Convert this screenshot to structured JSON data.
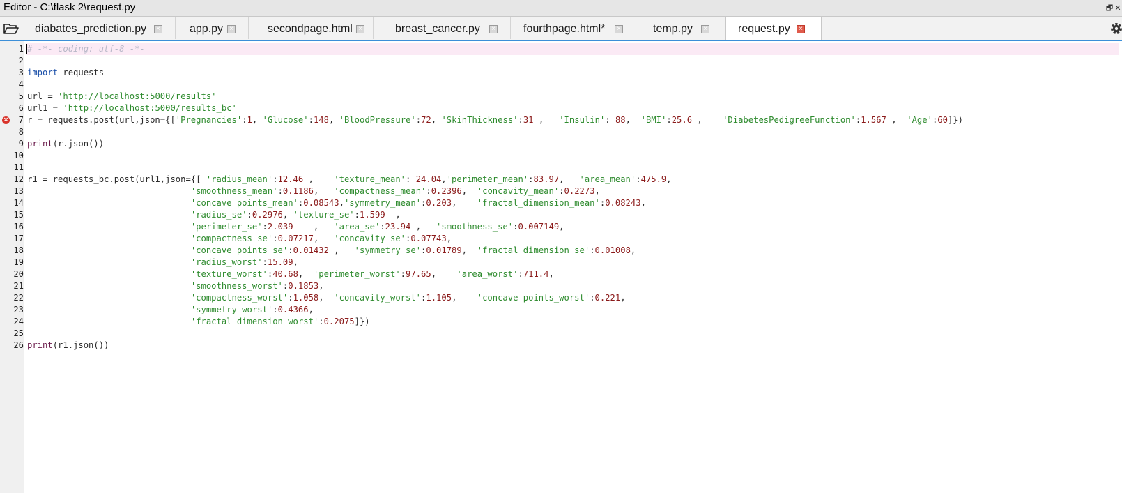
{
  "window": {
    "title": "Editor - C:\\flask 2\\request.py"
  },
  "tabs": [
    {
      "label": "diabates_prediction.py",
      "active": false
    },
    {
      "label": "app.py",
      "active": false
    },
    {
      "label": "secondpage.html",
      "active": false
    },
    {
      "label": "breast_cancer.py",
      "active": false
    },
    {
      "label": "fourthpage.html*",
      "active": false
    },
    {
      "label": "temp.py",
      "active": false
    },
    {
      "label": "request.py",
      "active": true
    }
  ],
  "icons": {
    "open": "folder-open-icon",
    "close": "close-icon",
    "settings": "gear-icon",
    "error": "error-icon"
  },
  "colors": {
    "keyword": "#1a4fa8",
    "string": "#2e8b2e",
    "number": "#8b1a1a",
    "comment": "#b8b8c8",
    "accent": "#3c8fd8",
    "error": "#d9342b"
  },
  "editor": {
    "error_line": 7,
    "lines": [
      {
        "n": "1",
        "tokens": [
          [
            "cm",
            "# -*- coding: utf-8 -*-"
          ]
        ]
      },
      {
        "n": "2",
        "tokens": []
      },
      {
        "n": "3",
        "tokens": [
          [
            "kw",
            "import"
          ],
          [
            "id",
            " requests"
          ]
        ]
      },
      {
        "n": "4",
        "tokens": []
      },
      {
        "n": "5",
        "tokens": [
          [
            "id",
            "url = "
          ],
          [
            "st",
            "'http://localhost:5000/results'"
          ]
        ]
      },
      {
        "n": "6",
        "tokens": [
          [
            "id",
            "url1 = "
          ],
          [
            "st",
            "'http://localhost:5000/results_bc'"
          ]
        ]
      },
      {
        "n": "7",
        "tokens": [
          [
            "id",
            "r = requests.post(url,json={["
          ],
          [
            "st",
            "'Pregnancies'"
          ],
          [
            "id",
            ":"
          ],
          [
            "nu",
            "1"
          ],
          [
            "id",
            ", "
          ],
          [
            "st",
            "'Glucose'"
          ],
          [
            "id",
            ":"
          ],
          [
            "nu",
            "148"
          ],
          [
            "id",
            ", "
          ],
          [
            "st",
            "'BloodPressure'"
          ],
          [
            "id",
            ":"
          ],
          [
            "nu",
            "72"
          ],
          [
            "id",
            ", "
          ],
          [
            "st",
            "'SkinThickness'"
          ],
          [
            "id",
            ":"
          ],
          [
            "nu",
            "31"
          ],
          [
            "id",
            " ,   "
          ],
          [
            "st",
            "'Insulin'"
          ],
          [
            "id",
            ": "
          ],
          [
            "nu",
            "88"
          ],
          [
            "id",
            ",  "
          ],
          [
            "st",
            "'BMI'"
          ],
          [
            "id",
            ":"
          ],
          [
            "nu",
            "25.6"
          ],
          [
            "id",
            " ,    "
          ],
          [
            "st",
            "'DiabetesPedigreeFunction'"
          ],
          [
            "id",
            ":"
          ],
          [
            "nu",
            "1.567"
          ],
          [
            "id",
            " ,  "
          ],
          [
            "st",
            "'Age'"
          ],
          [
            "id",
            ":"
          ],
          [
            "nu",
            "60"
          ],
          [
            "id",
            "]})"
          ]
        ]
      },
      {
        "n": "8",
        "tokens": []
      },
      {
        "n": "9",
        "tokens": [
          [
            "fn",
            "print"
          ],
          [
            "id",
            "(r.json())"
          ]
        ]
      },
      {
        "n": "10",
        "tokens": []
      },
      {
        "n": "11",
        "tokens": []
      },
      {
        "n": "12",
        "tokens": [
          [
            "id",
            "r1 = requests_bc.post(url1,json={[ "
          ],
          [
            "st",
            "'radius_mean'"
          ],
          [
            "id",
            ":"
          ],
          [
            "nu",
            "12.46"
          ],
          [
            "id",
            " ,    "
          ],
          [
            "st",
            "'texture_mean'"
          ],
          [
            "id",
            ": "
          ],
          [
            "nu",
            "24.04"
          ],
          [
            "id",
            ","
          ],
          [
            "st",
            "'perimeter_mean'"
          ],
          [
            "id",
            ":"
          ],
          [
            "nu",
            "83.97"
          ],
          [
            "id",
            ",   "
          ],
          [
            "st",
            "'area_mean'"
          ],
          [
            "id",
            ":"
          ],
          [
            "nu",
            "475.9"
          ],
          [
            "id",
            ","
          ]
        ]
      },
      {
        "n": "13",
        "tokens": [
          [
            "id",
            "                                "
          ],
          [
            "st",
            "'smoothness_mean'"
          ],
          [
            "id",
            ":"
          ],
          [
            "nu",
            "0.1186"
          ],
          [
            "id",
            ",   "
          ],
          [
            "st",
            "'compactness_mean'"
          ],
          [
            "id",
            ":"
          ],
          [
            "nu",
            "0.2396"
          ],
          [
            "id",
            ",  "
          ],
          [
            "st",
            "'concavity_mean'"
          ],
          [
            "id",
            ":"
          ],
          [
            "nu",
            "0.2273"
          ],
          [
            "id",
            ","
          ]
        ]
      },
      {
        "n": "14",
        "tokens": [
          [
            "id",
            "                                "
          ],
          [
            "st",
            "'concave points_mean'"
          ],
          [
            "id",
            ":"
          ],
          [
            "nu",
            "0.08543"
          ],
          [
            "id",
            ","
          ],
          [
            "st",
            "'symmetry_mean'"
          ],
          [
            "id",
            ":"
          ],
          [
            "nu",
            "0.203"
          ],
          [
            "id",
            ",    "
          ],
          [
            "st",
            "'fractal_dimension_mean'"
          ],
          [
            "id",
            ":"
          ],
          [
            "nu",
            "0.08243"
          ],
          [
            "id",
            ","
          ]
        ]
      },
      {
        "n": "15",
        "tokens": [
          [
            "id",
            "                                "
          ],
          [
            "st",
            "'radius_se'"
          ],
          [
            "id",
            ":"
          ],
          [
            "nu",
            "0.2976"
          ],
          [
            "id",
            ", "
          ],
          [
            "st",
            "'texture_se'"
          ],
          [
            "id",
            ":"
          ],
          [
            "nu",
            "1.599"
          ],
          [
            "id",
            "  ,"
          ]
        ]
      },
      {
        "n": "16",
        "tokens": [
          [
            "id",
            "                                "
          ],
          [
            "st",
            "'perimeter_se'"
          ],
          [
            "id",
            ":"
          ],
          [
            "nu",
            "2.039"
          ],
          [
            "id",
            "    ,   "
          ],
          [
            "st",
            "'area_se'"
          ],
          [
            "id",
            ":"
          ],
          [
            "nu",
            "23.94"
          ],
          [
            "id",
            " ,   "
          ],
          [
            "st",
            "'smoothness_se'"
          ],
          [
            "id",
            ":"
          ],
          [
            "nu",
            "0.007149"
          ],
          [
            "id",
            ","
          ]
        ]
      },
      {
        "n": "17",
        "tokens": [
          [
            "id",
            "                                "
          ],
          [
            "st",
            "'compactness_se'"
          ],
          [
            "id",
            ":"
          ],
          [
            "nu",
            "0.07217"
          ],
          [
            "id",
            ",   "
          ],
          [
            "st",
            "'concavity_se'"
          ],
          [
            "id",
            ":"
          ],
          [
            "nu",
            "0.07743"
          ],
          [
            "id",
            ","
          ]
        ]
      },
      {
        "n": "18",
        "tokens": [
          [
            "id",
            "                                "
          ],
          [
            "st",
            "'concave points_se'"
          ],
          [
            "id",
            ":"
          ],
          [
            "nu",
            "0.01432"
          ],
          [
            "id",
            " ,   "
          ],
          [
            "st",
            "'symmetry_se'"
          ],
          [
            "id",
            ":"
          ],
          [
            "nu",
            "0.01789"
          ],
          [
            "id",
            ",  "
          ],
          [
            "st",
            "'fractal_dimension_se'"
          ],
          [
            "id",
            ":"
          ],
          [
            "nu",
            "0.01008"
          ],
          [
            "id",
            ","
          ]
        ]
      },
      {
        "n": "19",
        "tokens": [
          [
            "id",
            "                                "
          ],
          [
            "st",
            "'radius_worst'"
          ],
          [
            "id",
            ":"
          ],
          [
            "nu",
            "15.09"
          ],
          [
            "id",
            ","
          ]
        ]
      },
      {
        "n": "20",
        "tokens": [
          [
            "id",
            "                                "
          ],
          [
            "st",
            "'texture_worst'"
          ],
          [
            "id",
            ":"
          ],
          [
            "nu",
            "40.68"
          ],
          [
            "id",
            ",  "
          ],
          [
            "st",
            "'perimeter_worst'"
          ],
          [
            "id",
            ":"
          ],
          [
            "nu",
            "97.65"
          ],
          [
            "id",
            ",    "
          ],
          [
            "st",
            "'area_worst'"
          ],
          [
            "id",
            ":"
          ],
          [
            "nu",
            "711.4"
          ],
          [
            "id",
            ","
          ]
        ]
      },
      {
        "n": "21",
        "tokens": [
          [
            "id",
            "                                "
          ],
          [
            "st",
            "'smoothness_worst'"
          ],
          [
            "id",
            ":"
          ],
          [
            "nu",
            "0.1853"
          ],
          [
            "id",
            ","
          ]
        ]
      },
      {
        "n": "22",
        "tokens": [
          [
            "id",
            "                                "
          ],
          [
            "st",
            "'compactness_worst'"
          ],
          [
            "id",
            ":"
          ],
          [
            "nu",
            "1.058"
          ],
          [
            "id",
            ",  "
          ],
          [
            "st",
            "'concavity_worst'"
          ],
          [
            "id",
            ":"
          ],
          [
            "nu",
            "1.105"
          ],
          [
            "id",
            ",    "
          ],
          [
            "st",
            "'concave points_worst'"
          ],
          [
            "id",
            ":"
          ],
          [
            "nu",
            "0.221"
          ],
          [
            "id",
            ","
          ]
        ]
      },
      {
        "n": "23",
        "tokens": [
          [
            "id",
            "                                "
          ],
          [
            "st",
            "'symmetry_worst'"
          ],
          [
            "id",
            ":"
          ],
          [
            "nu",
            "0.4366"
          ],
          [
            "id",
            ","
          ]
        ]
      },
      {
        "n": "24",
        "tokens": [
          [
            "id",
            "                                "
          ],
          [
            "st",
            "'fractal_dimension_worst'"
          ],
          [
            "id",
            ":"
          ],
          [
            "nu",
            "0.2075"
          ],
          [
            "id",
            "]})"
          ]
        ]
      },
      {
        "n": "25",
        "tokens": []
      },
      {
        "n": "26",
        "tokens": [
          [
            "fn",
            "print"
          ],
          [
            "id",
            "(r1.json())"
          ]
        ]
      }
    ]
  }
}
